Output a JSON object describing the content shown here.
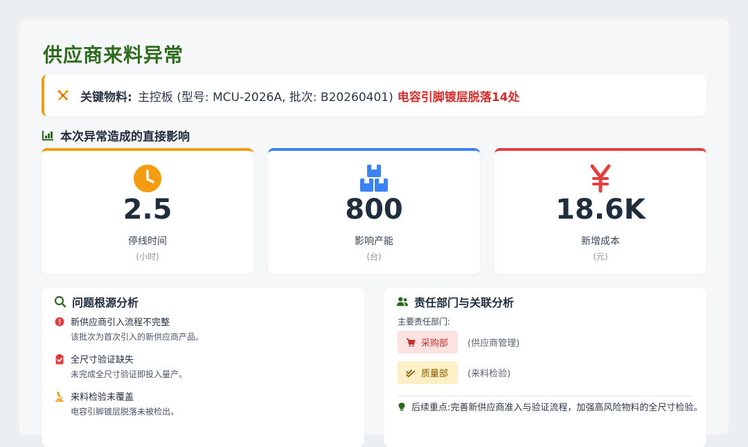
{
  "title": "供应商来料异常",
  "key_material": {
    "label": "关键物料:",
    "desc": "主控板 (型号: MCU-2026A, 批次: B20260401)",
    "highlight": "电容引脚镀层脱落14处",
    "icon": "tools-icon",
    "accent": "#f39c12"
  },
  "impact": {
    "heading": "本次异常造成的直接影响",
    "stats": [
      {
        "value": "2.5",
        "label": "停线时间",
        "unit": "(小时)",
        "icon": "clock-icon",
        "color": "#f39c12"
      },
      {
        "value": "800",
        "label": "影响产能",
        "unit": "(台)",
        "icon": "boxes-icon",
        "color": "#3b82f6"
      },
      {
        "value": "18.6K",
        "label": "新增成本",
        "unit": "(元)",
        "icon": "yen-icon",
        "color": "#e53e3e"
      }
    ]
  },
  "root_cause": {
    "heading": "问题根源分析",
    "items": [
      {
        "title": "新供应商引入流程不完整",
        "desc": "该批次为首次引入的新供应商产品。",
        "icon": "exclamation-circle-icon"
      },
      {
        "title": "全尺寸验证缺失",
        "desc": "未完成全尺寸验证即投入量产。",
        "icon": "clipboard-check-icon"
      },
      {
        "title": "来料检验未覆盖",
        "desc": "电容引脚镀层脱落未被检出。",
        "icon": "microscope-icon"
      }
    ]
  },
  "responsibility": {
    "heading": "责任部门与关联分析",
    "sub_label": "主要责任部门:",
    "departments": [
      {
        "name": "采购部",
        "note": "(供应商管理)",
        "icon": "cart-icon"
      },
      {
        "name": "质量部",
        "note": "(来料检验)",
        "icon": "check-double-icon"
      }
    ],
    "focus": "后续重点:完善新供应商准入与验证流程，加强高风险物料的全尺寸检验。"
  }
}
